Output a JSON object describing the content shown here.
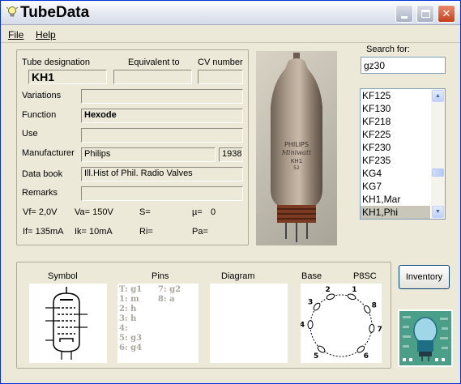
{
  "window": {
    "title": "TubeData"
  },
  "menu": {
    "file": "File",
    "help": "Help"
  },
  "details": {
    "tube_designation_label": "Tube designation",
    "equivalent_to_label": "Equivalent to",
    "cv_number_label": "CV number",
    "tube_designation": "KH1",
    "equivalent_to": "",
    "cv_number": "",
    "variations_label": "Variations",
    "variations": "",
    "function_label": "Function",
    "function": "Hexode",
    "use_label": "Use",
    "use": "",
    "manufacturer_label": "Manufacturer",
    "manufacturer": "Philips",
    "year": "1938",
    "data_book_label": "Data book",
    "data_book": "Ill.Hist of Phil. Radio Valves",
    "remarks_label": "Remarks",
    "remarks": "",
    "params_row1": {
      "vf": "Vf= 2,0V",
      "va": "Va= 150V",
      "s": "S=",
      "mu": "µ=",
      "mu_value": "0"
    },
    "params_row2": {
      "if": "If= 135mA",
      "ik": "Ik= 10mA",
      "ri": "Ri=",
      "pa": "Pa="
    }
  },
  "photo": {
    "brand": "PHILIPS",
    "series": "Miniwatt",
    "type": "KH1",
    "code": "52"
  },
  "search": {
    "label": "Search for:",
    "value": "gz30"
  },
  "tube_list": {
    "items": [
      "KF125",
      "KF130",
      "KF218",
      "KF225",
      "KF230",
      "KF235",
      "KG4",
      "KG7",
      "KH1,Mar",
      "KH1,Phi"
    ],
    "selected": "KH1,Phi"
  },
  "bottom": {
    "symbol_label": "Symbol",
    "pins_label": "Pins",
    "diagram_label": "Diagram",
    "base_label": "Base",
    "base_type": "P8SC",
    "pins_col1": [
      "T: g1",
      "1: m",
      "2: h",
      "3: h",
      "4:",
      "5: g3",
      "6: g4"
    ],
    "pins_col2": [
      "7: g2",
      "8: a"
    ],
    "base_pin_numbers": [
      "1",
      "2",
      "3",
      "4",
      "5",
      "6",
      "7",
      "8"
    ]
  },
  "buttons": {
    "inventory": "Inventory"
  },
  "colors": {
    "titlebar_close": "#c4401c",
    "selection": "#c9c7ba",
    "logo": "#4b9f88"
  },
  "icons": [
    "lightbulb-icon",
    "minimize-icon",
    "maximize-icon",
    "close-icon",
    "scroll-up-icon",
    "scroll-down-icon"
  ]
}
